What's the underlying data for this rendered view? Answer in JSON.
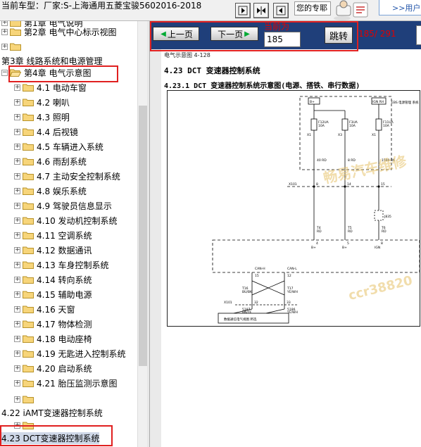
{
  "header": {
    "car_title": "当前车型：厂家:S-上海通用五菱宝骏5602016-2018",
    "msg": "您的专耶",
    "user_link": ">>用户"
  },
  "tree": {
    "items": [
      {
        "label": "第1章 电气说明",
        "level": 0,
        "folder": true
      },
      {
        "label": "第2章 电气中心标示视图",
        "level": 0,
        "folder": true
      },
      {
        "label": "",
        "level": 0,
        "folder": true
      },
      {
        "label": "第3章 线路系统和电源管理",
        "level": -1,
        "folder": false
      },
      {
        "label": "第4章 电气示意图",
        "level": 0,
        "folder": true,
        "open": true
      },
      {
        "label": "4.1 电动车窗",
        "level": 1,
        "folder": true
      },
      {
        "label": "4.2 喇叭",
        "level": 1,
        "folder": true
      },
      {
        "label": "4.3 照明",
        "level": 1,
        "folder": true
      },
      {
        "label": "4.4 后视镜",
        "level": 1,
        "folder": true
      },
      {
        "label": "4.5 车辆进入系统",
        "level": 1,
        "folder": true
      },
      {
        "label": "4.6 雨刮系统",
        "level": 1,
        "folder": true
      },
      {
        "label": "4.7 主动安全控制系统",
        "level": 1,
        "folder": true
      },
      {
        "label": "4.8 娱乐系统",
        "level": 1,
        "folder": true
      },
      {
        "label": "4.9 驾驶员信息显示",
        "level": 1,
        "folder": true
      },
      {
        "label": "4.10 发动机控制系统",
        "level": 1,
        "folder": true
      },
      {
        "label": "4.11 空调系统",
        "level": 1,
        "folder": true
      },
      {
        "label": "4.12 数据通讯",
        "level": 1,
        "folder": true
      },
      {
        "label": "4.13 车身控制系统",
        "level": 1,
        "folder": true
      },
      {
        "label": "4.14 转向系统",
        "level": 1,
        "folder": true
      },
      {
        "label": "4.15 辅助电源",
        "level": 1,
        "folder": true
      },
      {
        "label": "4.16 天窗",
        "level": 1,
        "folder": true
      },
      {
        "label": "4.17 物体检测",
        "level": 1,
        "folder": true
      },
      {
        "label": "4.18 电动座椅",
        "level": 1,
        "folder": true
      },
      {
        "label": "4.19 无匙进入控制系统",
        "level": 1,
        "folder": true
      },
      {
        "label": "4.20 启动系统",
        "level": 1,
        "folder": true
      },
      {
        "label": "4.21 胎压监测示意图",
        "level": 1,
        "folder": true
      },
      {
        "label": "",
        "level": 1,
        "folder": true
      },
      {
        "label": "4.22 iAMT变速器控制系统",
        "level": -1,
        "folder": false
      },
      {
        "label": "",
        "level": 1,
        "folder": true
      },
      {
        "label": "4.23 DCT变速器控制系统",
        "level": -1,
        "folder": false,
        "selected": true
      }
    ]
  },
  "toolbar": {
    "prev_label": "上一页",
    "next_label": "下一页",
    "current_label": "当前为",
    "current_value": "185",
    "jump_label": "跳转",
    "page_count": "185/ 291"
  },
  "doc": {
    "fig_label": "电气示意图 4-128",
    "section_title": "4.23 DCT 变速器控制系统",
    "subsection_title": "4.23.1 DCT 变速器控制系统示意图(电源、搭铁、串行数据)",
    "watermark_1": "畅易汽车维修",
    "watermark_2": "ccr38820"
  },
  "diagram": {
    "relay_boxes": [
      "B+",
      "IGN RH"
    ],
    "fuses": [
      {
        "name": "F12UA",
        "rating": "10A"
      },
      {
        "name": "F3UA",
        "rating": "10A"
      },
      {
        "name": "F11UA",
        "rating": "10A"
      }
    ],
    "fuse_pins": [
      "X1",
      "X3",
      "X1"
    ],
    "wire_labels": [
      "40 RD",
      "8 RD",
      "1590 BK"
    ],
    "connector": "X101",
    "connector_pins": [
      "8",
      "14",
      "15"
    ],
    "jumper": "J835",
    "module_pins": [
      {
        "name": "T4",
        "wire": "RD",
        "pin": "4"
      },
      {
        "name": "T5",
        "wire": "RD",
        "pin": "5"
      },
      {
        "name": "T6",
        "wire": "RD",
        "pin": "8"
      }
    ],
    "module_labels": [
      "B+",
      "B+",
      "IGN"
    ],
    "can_labels": [
      "CAN-H",
      "CAN-L"
    ],
    "can_pins": [
      "15",
      "12"
    ],
    "can_wires": [
      {
        "name": "T16",
        "color": "BU/BK"
      },
      {
        "name": "T17",
        "color": "YE/WH"
      }
    ],
    "can_connector": "X101",
    "can_connector_pins": [
      "32",
      "33"
    ],
    "lower_wires": [
      {
        "id": "5187",
        "color": "BN/YE"
      },
      {
        "id": "5186",
        "color": "YE/WH"
      }
    ],
    "bottom_box": "数据通信电气视图 所选",
    "note": "EBS 电源管理 系统"
  }
}
